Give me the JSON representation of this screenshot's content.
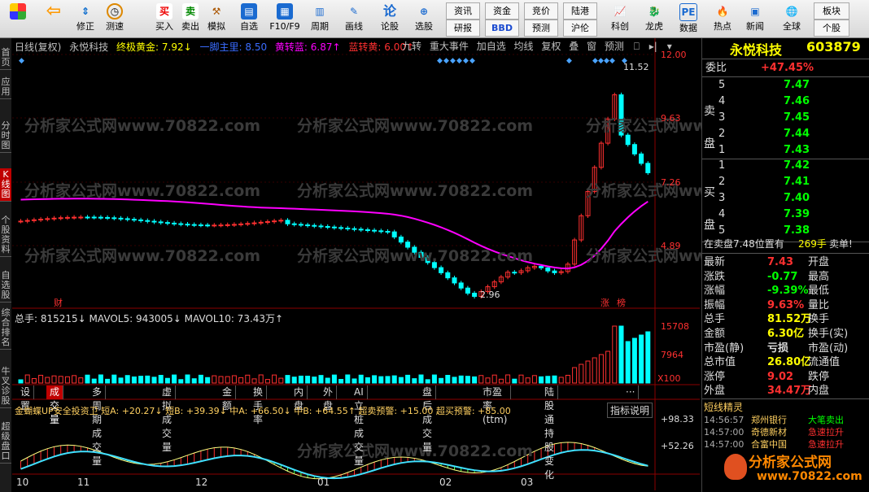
{
  "toolbar": {
    "buttons": [
      "修正",
      "测速",
      "买入",
      "卖出",
      "模拟",
      "自选",
      "F10/F9",
      "周期",
      "画线",
      "论股",
      "选股",
      "研报",
      "预测",
      "沪伦",
      "科创",
      "龙虎",
      "数据",
      "热点",
      "新闻",
      "全球",
      "个股"
    ],
    "small_buttons": [
      "资讯",
      "资金",
      "竞价",
      "陆港",
      "BBD",
      "板块"
    ]
  },
  "left_tabs": [
    "首页",
    "应用",
    "分时图",
    "K线图",
    "个股资料",
    "自选股",
    "综合排名",
    "牛叉诊股",
    "超级盘口"
  ],
  "chart_header": {
    "period": "日线(复权)",
    "stock": "永悦科技",
    "ind1_label": "终极黄金: 7.92↓",
    "ind2_label": "一脚主里: 8.50",
    "ind3_label": "黄转蓝: 6.87↑",
    "ind4_label": "蓝转黄: 6.00↑"
  },
  "chart_toolbar": [
    "九转",
    "重大事件",
    "加自选",
    "均线",
    "复权",
    "叠",
    "窗",
    "预测"
  ],
  "price_axis": [
    "12.00",
    "9.63",
    "7.26",
    "4.89"
  ],
  "price_marks": {
    "high": "11.52",
    "low": "2.96"
  },
  "chart_flags": {
    "cai": "财",
    "zhang": "涨",
    "bang": "榜"
  },
  "volume": {
    "header": "总手: 815215↓  MAVOL5: 943005↓  MAVOL10: 73.43万↑",
    "axis": [
      "15708",
      "7964",
      "X100"
    ]
  },
  "bottom_tabs": [
    "设置",
    "成交量",
    "多周期成交量",
    "虚拟成交量",
    "金额",
    "换手率",
    "内盘",
    "外盘",
    "AI立桩成交量",
    "盘后成交量",
    "市盈率(ttm)",
    "陆股通持股变化",
    "···"
  ],
  "indicator": {
    "header_left": "金蝴蝶UP安全投资卫  短A: +20.27↓  短B: +39.39↓  中A: +66.50↓  中B: +64.55↑  超卖预警: +15.00  超买预警: +85.00",
    "explain": "指标说明",
    "axis": [
      "+98.33",
      "+52.26"
    ]
  },
  "time_axis": [
    "10",
    "11",
    "12",
    "01",
    "02",
    "03"
  ],
  "quote": {
    "name": "永悦科技",
    "code": "603879",
    "weibi_label": "委比",
    "weibi": "+47.45%",
    "sell_label": "卖盘",
    "buy_label": "买盘",
    "sells": [
      [
        "5",
        "7.47"
      ],
      [
        "4",
        "7.46"
      ],
      [
        "3",
        "7.45"
      ],
      [
        "2",
        "7.44"
      ],
      [
        "1",
        "7.43"
      ]
    ],
    "buys": [
      [
        "1",
        "7.42"
      ],
      [
        "2",
        "7.41"
      ],
      [
        "3",
        "7.40"
      ],
      [
        "4",
        "7.39"
      ],
      [
        "5",
        "7.38"
      ]
    ],
    "inline": "在卖盘7.48位置有",
    "inline_vol": "269手",
    "inline_tag": "卖单!",
    "stats": [
      [
        "最新",
        "7.43",
        "开盘",
        ""
      ],
      [
        "涨跌",
        "-0.77",
        "最高",
        ""
      ],
      [
        "涨幅",
        "-9.39%",
        "最低",
        ""
      ],
      [
        "振幅",
        "9.63%",
        "量比",
        ""
      ],
      [
        "总手",
        "81.52万",
        "换手",
        ""
      ],
      [
        "金额",
        "6.30亿",
        "换手(实)",
        ""
      ],
      [
        "市盈(静)",
        "亏损",
        "市盈(动)",
        ""
      ],
      [
        "总市值",
        "26.80亿",
        "流通值",
        ""
      ],
      [
        "涨停",
        "9.02",
        "跌停",
        ""
      ],
      [
        "外盘",
        "34.47万",
        "内盘",
        ""
      ]
    ],
    "elves_title": "短线精灵",
    "elves": [
      [
        "14:56:57",
        "郑州银行",
        "大笔卖出"
      ],
      [
        "14:57:00",
        "奇德新材",
        "急速拉升"
      ],
      [
        "14:57:00",
        "合富中国",
        "急速拉升"
      ]
    ]
  },
  "watermark": "分析家公式网www.70822.com",
  "logo_text": "分析家公式网",
  "logo_url": "www.70822.com",
  "colors": {
    "up": "#ff3030",
    "down": "#00ffff",
    "ma": "#ff00ff",
    "accent": "#ffff00"
  }
}
